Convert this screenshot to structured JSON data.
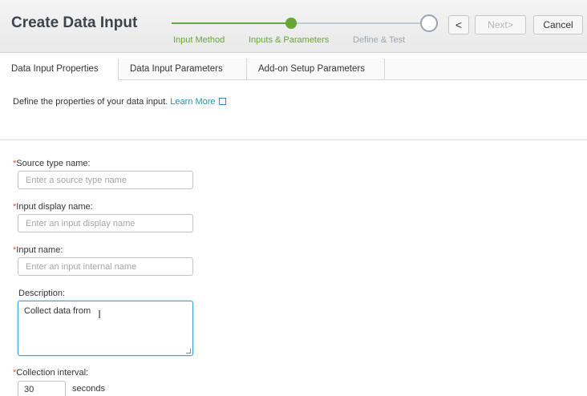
{
  "header": {
    "title": "Create Data Input",
    "steps": [
      "Input Method",
      "Inputs & Parameters",
      "Define & Test"
    ],
    "prev_label": "<",
    "next_label": "Next>",
    "cancel_label": "Cancel"
  },
  "tabs": [
    "Data Input Properties",
    "Data Input Parameters",
    "Add-on Setup Parameters"
  ],
  "intro": {
    "text": "Define the properties of your data input.",
    "link": "Learn More"
  },
  "form": {
    "source_type": {
      "label": "Source type name:",
      "placeholder": "Enter a source type name",
      "value": ""
    },
    "display_name": {
      "label": "Input display name:",
      "placeholder": "Enter an input display name",
      "value": ""
    },
    "input_name": {
      "label": "Input name:",
      "placeholder": "Enter an input internal name",
      "value": ""
    },
    "description": {
      "label": "Description:",
      "value": "Collect data from"
    },
    "interval": {
      "label": "Collection interval:",
      "value": "30",
      "unit": "seconds"
    }
  },
  "colors": {
    "accent_green": "#65a637",
    "link_blue": "#1e93c6",
    "required_red": "#d6563c"
  }
}
